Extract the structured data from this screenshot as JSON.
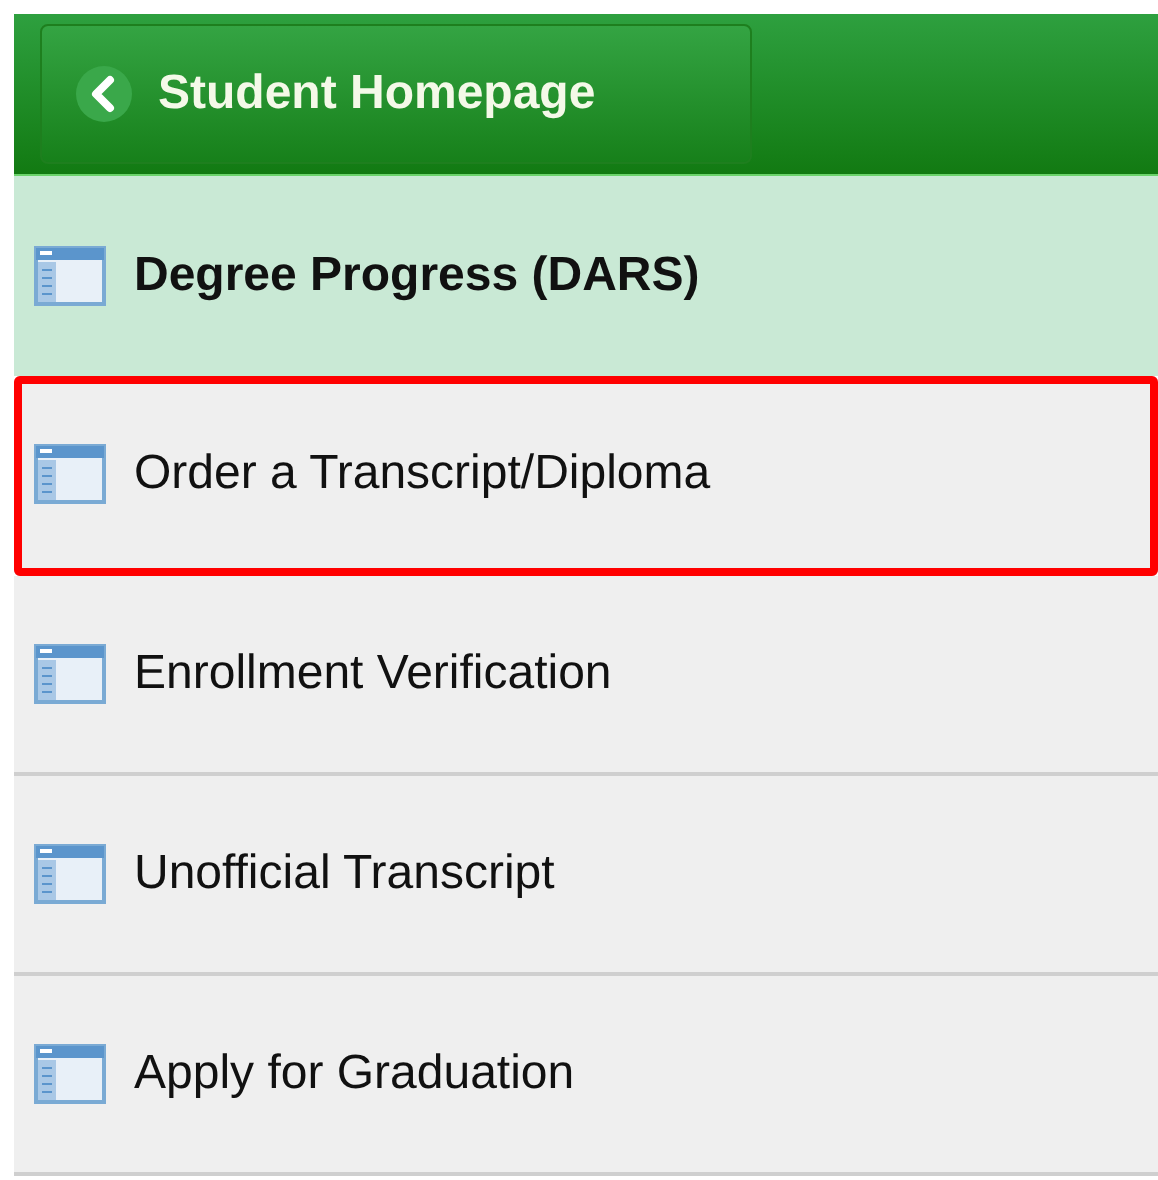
{
  "header": {
    "back_button": {
      "label": "Student Homepage"
    }
  },
  "menu": [
    {
      "label": "Degree Progress (DARS)",
      "selected": true,
      "highlighted": false
    },
    {
      "label": "Order a Transcript/Diploma",
      "selected": false,
      "highlighted": true
    },
    {
      "label": "Enrollment Verification",
      "selected": false,
      "highlighted": false
    },
    {
      "label": "Unofficial Transcript",
      "selected": false,
      "highlighted": false
    },
    {
      "label": "Apply for Graduation",
      "selected": false,
      "highlighted": false
    }
  ]
}
